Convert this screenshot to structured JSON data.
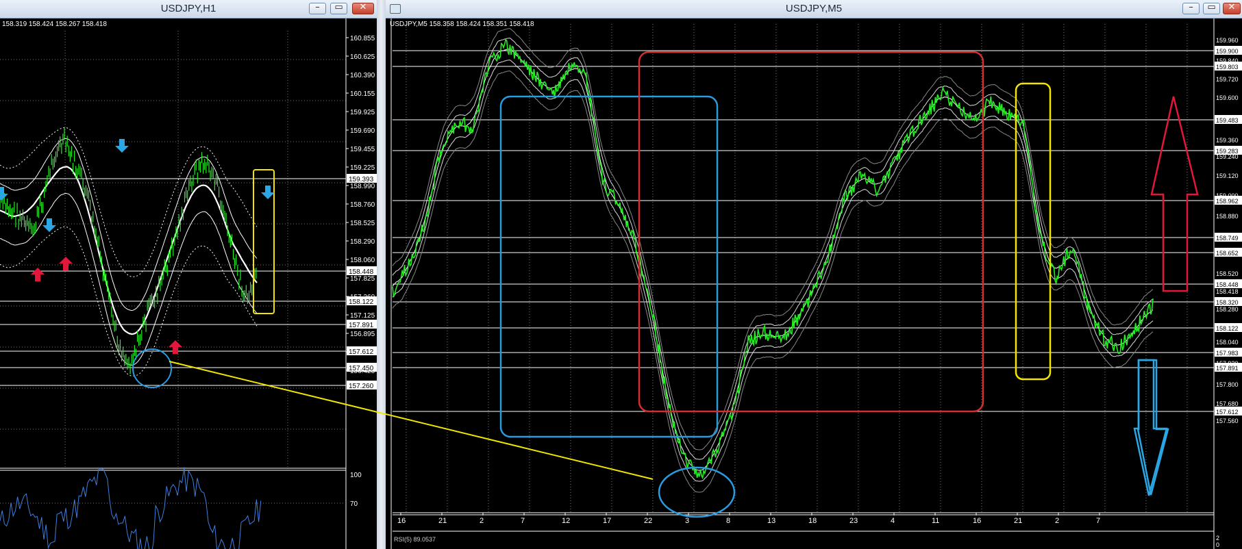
{
  "left_window": {
    "title": "USDJPY,H1",
    "ohlc": "158.319 158.424 158.267 158.418",
    "price_ticks": [
      "160.855",
      "160.625",
      "160.390",
      "160.155",
      "159.925",
      "159.690",
      "159.455",
      "159.225",
      "158.990",
      "158.760",
      "158.525",
      "158.290",
      "158.060",
      "157.825",
      "157.360",
      "157.125",
      "156.895",
      "156.660",
      "156.425"
    ],
    "price_markers": [
      "159.393",
      "158.448",
      "158.122",
      "157.891",
      "157.612",
      "157.450",
      "157.260"
    ],
    "rsi_levels": [
      "100",
      "70"
    ],
    "buttons": {
      "minimize": "–",
      "maximize": "▭",
      "close": "✕"
    }
  },
  "right_window": {
    "title": "USDJPY,M5",
    "ohlc": "USDJPY,M5  158.358 158.424 158.351 158.418",
    "price_labels": [
      "159.960",
      "159.900",
      "159.840",
      "159.803",
      "159.720",
      "159.600",
      "159.483",
      "159.360",
      "159.283",
      "159.240",
      "159.120",
      "159.000",
      "158.962",
      "158.880",
      "158.749",
      "158.652",
      "158.520",
      "158.448",
      "158.418",
      "158.320",
      "158.280",
      "158.122",
      "158.040",
      "157.983",
      "157.920",
      "157.891",
      "157.800",
      "157.680",
      "157.612",
      "157.560"
    ],
    "time_labels": [
      "16",
      "21",
      "2",
      "7",
      "12",
      "17",
      "22",
      "3",
      "8",
      "13",
      "18",
      "23",
      "4",
      "11",
      "16",
      "21",
      "2",
      "7"
    ],
    "rsi_label": "RSI(5) 89.0537",
    "rsi_corner": [
      "2",
      "0"
    ],
    "buttons": {
      "minimize": "–",
      "maximize": "▭",
      "close": "✕"
    }
  },
  "colors": {
    "price_line": "#22ee22",
    "annot_blue": "#2b9be0",
    "annot_red": "#d32f2f",
    "annot_yellow": "#f2e600",
    "arrow_red": "#e3163b",
    "arrow_blue": "#2aa7e6"
  }
}
